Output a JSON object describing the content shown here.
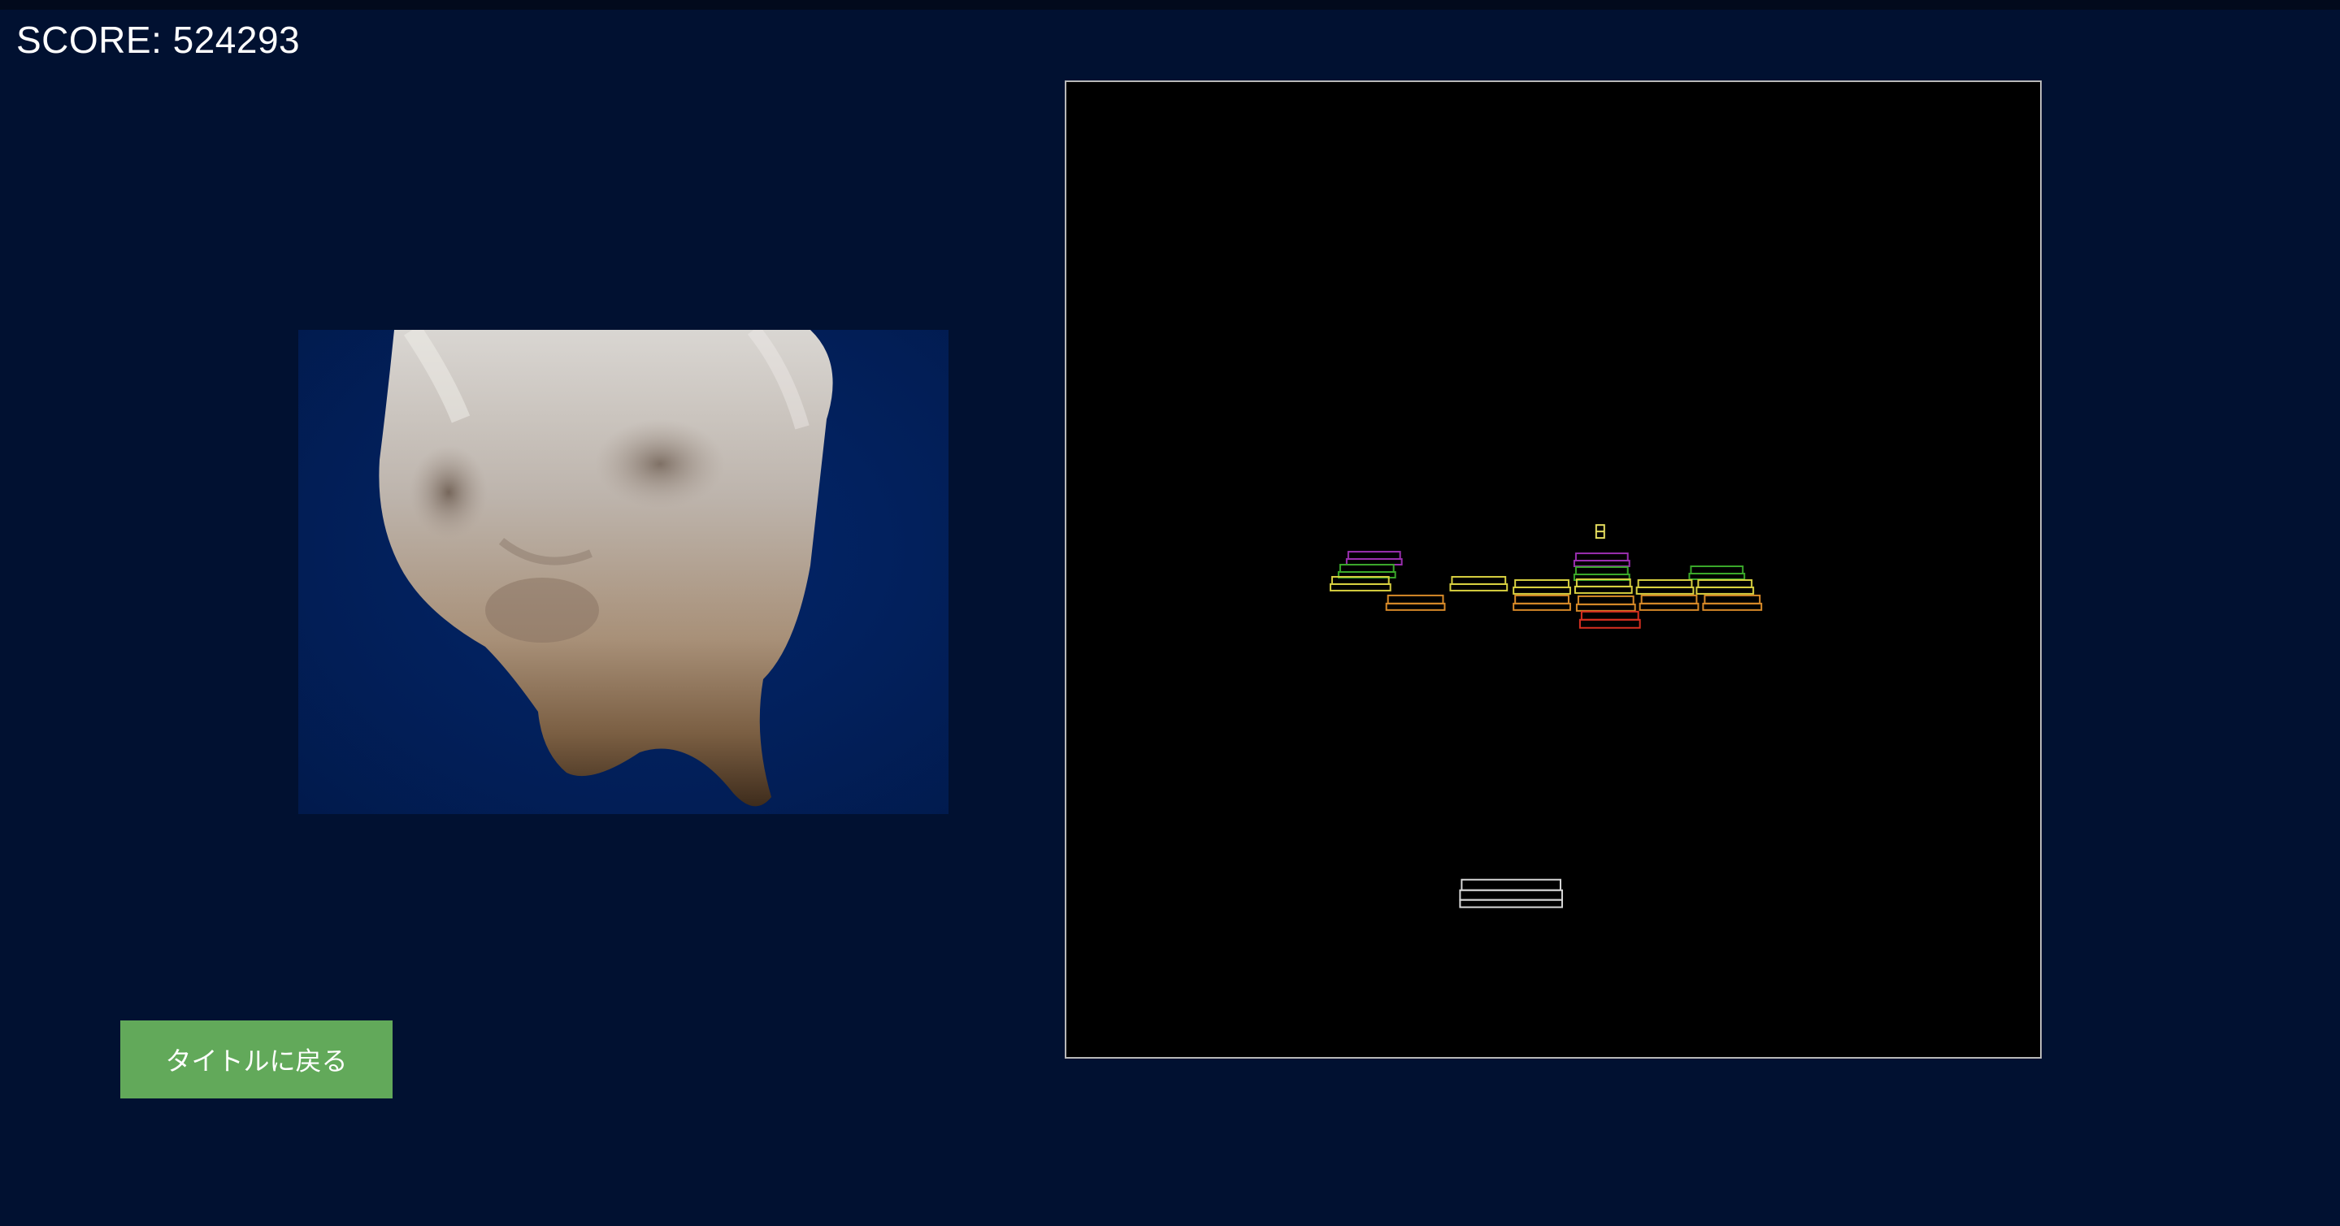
{
  "hud": {
    "score_text": "SCORE: 524293"
  },
  "camera": {
    "content": "webcam-feed-cat-face"
  },
  "controls": {
    "back_to_title_label": "タイトルに戻る"
  },
  "game": {
    "colors": {
      "background": "#000000",
      "border": "#b8b8b8",
      "paddle": "#d8d8d8",
      "ball": "#e8e060"
    },
    "brick_colors": {
      "purple": "#9b2fb0",
      "green": "#3aa82a",
      "yellow": "#d8d040",
      "orange": "#d88a28",
      "red": "#d83020"
    }
  },
  "theme": {
    "page_background": "#011131",
    "button_color": "#62a95a"
  }
}
